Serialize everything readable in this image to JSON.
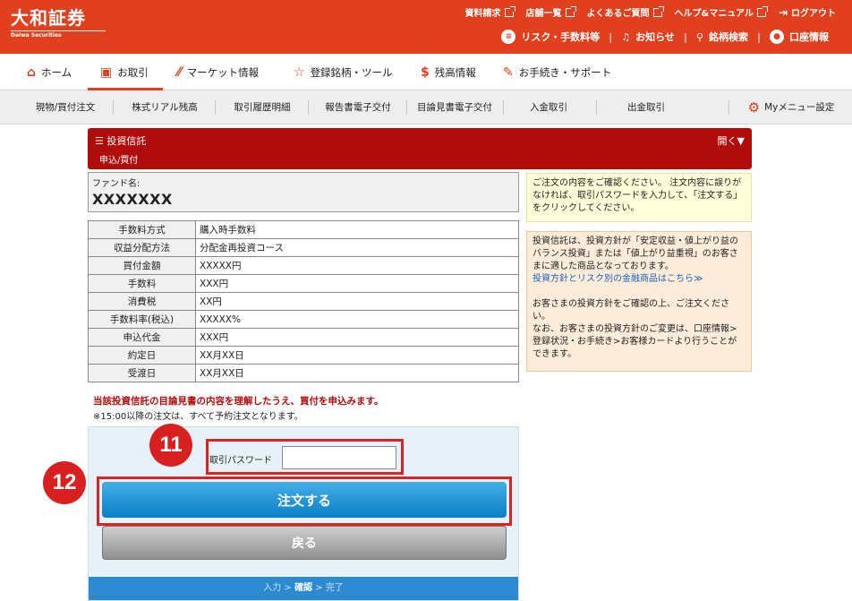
{
  "header": {
    "logo": "大和証券",
    "logo_sub": "Daiwa Securities",
    "links": [
      "資料請求",
      "店舗一覧",
      "よくあるご質問",
      "ヘルプ&マニュアル"
    ],
    "logout": "ログアウト",
    "risk": "リスク・手数料等",
    "notice": "お知らせ",
    "search": "銘柄検索",
    "account": "口座情報"
  },
  "nav": {
    "items": [
      "ホーム",
      "お取引",
      "マーケット情報",
      "登録銘柄・ツール",
      "残高情報",
      "お手続き・サポート"
    ]
  },
  "subnav": {
    "items": [
      "現物/買付注文",
      "株式リアル残高",
      "取引履歴明細",
      "報告書電子交付",
      "目論見書電子交付",
      "入金取引",
      "出金取引"
    ],
    "my_menu": "Myメニュー設定"
  },
  "section": {
    "title": "投資信託",
    "subtitle": "申込/買付",
    "open": "開く▼"
  },
  "fund": {
    "label": "ファンド名:",
    "name": "XXXXXXX"
  },
  "details": [
    {
      "k": "手数料方式",
      "v": "購入時手数料"
    },
    {
      "k": "収益分配方法",
      "v": "分配金再投資コース"
    },
    {
      "k": "買付金額",
      "v": "XXXXX円"
    },
    {
      "k": "手数料",
      "v": "XXX円"
    },
    {
      "k": "消費税",
      "v": "XX円"
    },
    {
      "k": "手数料率(税込)",
      "v": "XXXXX%"
    },
    {
      "k": "申込代金",
      "v": "XXX円"
    },
    {
      "k": "約定日",
      "v": "XX月XX日"
    },
    {
      "k": "受渡日",
      "v": "XX月XX日"
    }
  ],
  "notices": {
    "confirm": "当該投資信託の目論見書の内容を理解したうえ、買付を申込みます。",
    "time": "※15:00以降の注文は、すべて予約注文となります。"
  },
  "order": {
    "password_label": "取引パスワード",
    "password_value": "",
    "submit": "注文する",
    "back": "戻る",
    "steps": {
      "input": "入力",
      "sep1": " > ",
      "confirm": "確認",
      "sep2": " > ",
      "done": "完了"
    }
  },
  "badges": {
    "b11": "11",
    "b12": "12"
  },
  "side": {
    "yellow": "ご注文の内容をご確認ください。 注文内容に誤りがなければ、取引パスワードを入力して、「注文する」をクリックしてください。",
    "orange1": "投資信託は、投資方針が「安定収益・値上がり益のバランス投資」または「値上がり益重視」のお客さまに適した商品となっております。",
    "orange_link": "投資方針とリスク別の金融商品はこちら≫",
    "orange2": "お客さまの投資方針をご確認の上、ご注文ください。",
    "orange3": "なお、お客さまの投資方針のご変更は、口座情報>登録状況・お手続き>お客様カードより行うことができます。"
  },
  "colors": {
    "brand": "#e0401e",
    "section": "#b10c0c",
    "primary_button": "#0a7fc6",
    "highlight": "#dd2222"
  }
}
